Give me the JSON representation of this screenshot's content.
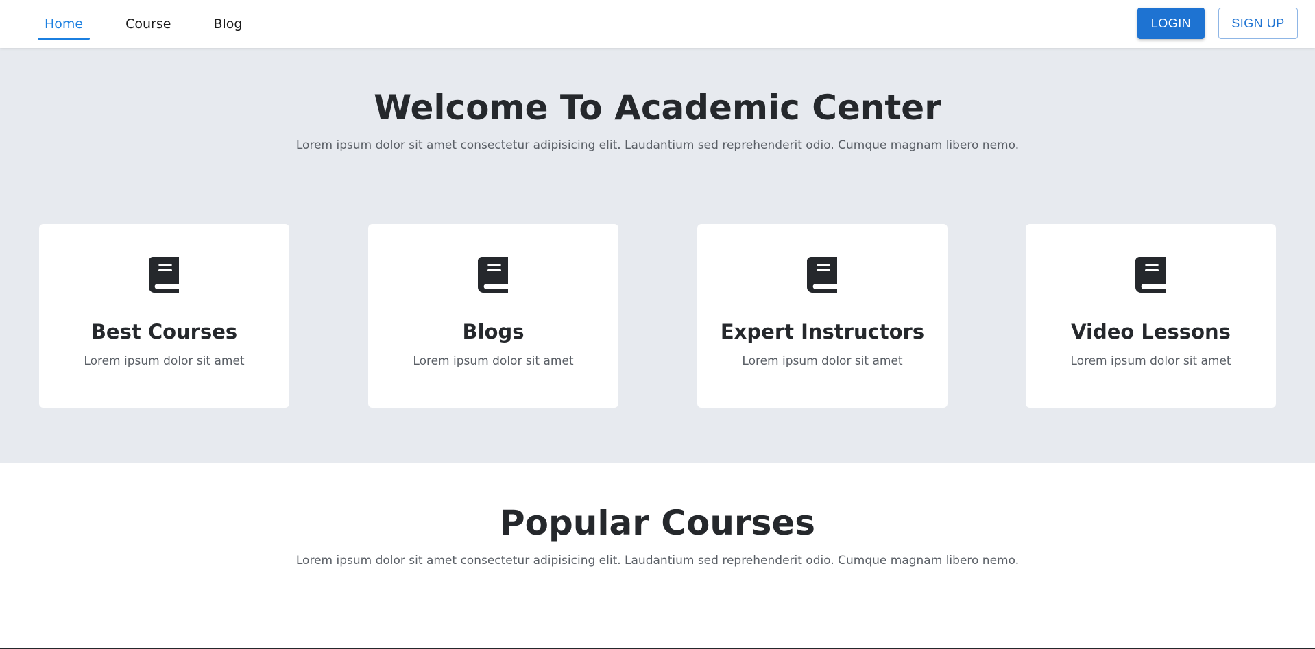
{
  "nav": {
    "tabs": [
      {
        "label": "Home",
        "active": true
      },
      {
        "label": "Course",
        "active": false
      },
      {
        "label": "Blog",
        "active": false
      }
    ],
    "login_label": "LOGIN",
    "signup_label": "SIGN UP"
  },
  "hero": {
    "title": "Welcome To Academic Center",
    "subtitle": "Lorem ipsum dolor sit amet consectetur adipisicing elit. Laudantium sed reprehenderit odio. Cumque magnam libero nemo."
  },
  "features": [
    {
      "icon": "book-icon",
      "title": "Best Courses",
      "description": "Lorem ipsum dolor sit amet"
    },
    {
      "icon": "book-icon",
      "title": "Blogs",
      "description": "Lorem ipsum dolor sit amet"
    },
    {
      "icon": "book-icon",
      "title": "Expert Instructors",
      "description": "Lorem ipsum dolor sit amet"
    },
    {
      "icon": "book-icon",
      "title": "Video Lessons",
      "description": "Lorem ipsum dolor sit amet"
    }
  ],
  "popular": {
    "title": "Popular Courses",
    "subtitle": "Lorem ipsum dolor sit amet consectetur adipisicing elit. Laudantium sed reprehenderit odio. Cumque magnam libero nemo."
  },
  "colors": {
    "accent": "#1b7fe0",
    "button_primary": "#1e73d2",
    "hero_background": "#e7eaef",
    "heading": "#25282c",
    "muted_text": "#5a5f66"
  }
}
